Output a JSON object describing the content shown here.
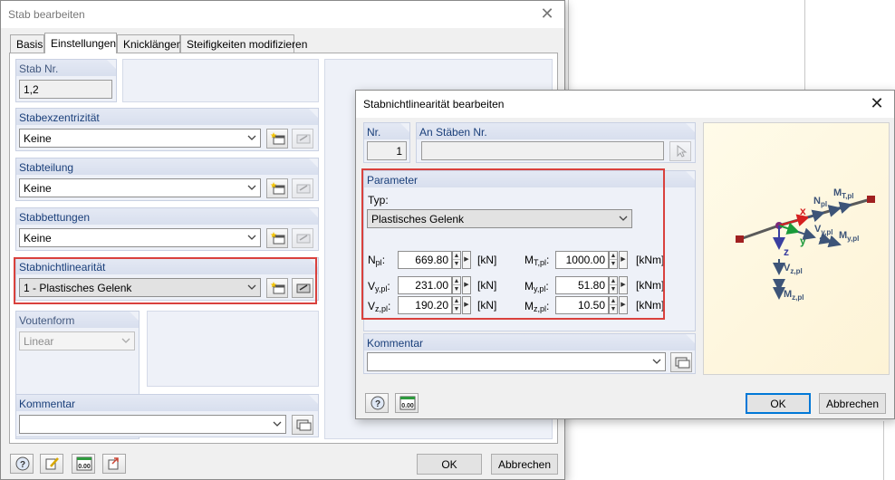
{
  "main_dialog": {
    "title": "Stab bearbeiten",
    "tabs": [
      "Basis",
      "Einstellungen",
      "Knicklängen",
      "Steifigkeiten modifizieren"
    ],
    "active_tab": "Einstellungen",
    "stab_nr": {
      "label": "Stab Nr.",
      "value": "1,2"
    },
    "exzentrizitaet": {
      "label": "Stabexzentrizität",
      "value": "Keine"
    },
    "teilung": {
      "label": "Stabteilung",
      "value": "Keine"
    },
    "bettungen": {
      "label": "Stabbettungen",
      "value": "Keine"
    },
    "nichtlinearitaet": {
      "label": "Stabnichtlinearität",
      "value": "1 - Plastisches Gelenk"
    },
    "voutenform": {
      "label": "Voutenform",
      "value": "Linear"
    },
    "kommentar": {
      "label": "Kommentar",
      "value": ""
    },
    "ok_label": "OK",
    "cancel_label": "Abbrechen",
    "calc_icon_text": "0.00"
  },
  "sub_dialog": {
    "title": "Stabnichtlinearität bearbeiten",
    "nr": {
      "label": "Nr.",
      "value": "1"
    },
    "an_staeben": {
      "label": "An Stäben Nr.",
      "value": ""
    },
    "parameter_label": "Parameter",
    "typ_label": "Typ:",
    "typ_value": "Plastisches Gelenk",
    "params_left": [
      {
        "base": "N",
        "sub": "pl",
        "colon": ":",
        "value": "669.80",
        "unit": "[kN]"
      },
      {
        "base": "V",
        "sub": "y,pl",
        "colon": ":",
        "value": "231.00",
        "unit": "[kN]"
      },
      {
        "base": "V",
        "sub": "z,pl",
        "colon": ":",
        "value": "190.20",
        "unit": "[kN]"
      }
    ],
    "params_right": [
      {
        "base": "M",
        "sub": "T,pl",
        "colon": ":",
        "value": "1000.00",
        "unit": "[kNm]"
      },
      {
        "base": "M",
        "sub": "y,pl",
        "colon": ":",
        "value": "51.80",
        "unit": "[kNm]"
      },
      {
        "base": "M",
        "sub": "z,pl",
        "colon": ":",
        "value": "10.50",
        "unit": "[kNm]"
      }
    ],
    "kommentar": {
      "label": "Kommentar",
      "value": ""
    },
    "ok_label": "OK",
    "cancel_label": "Abbrechen",
    "calc_icon_text": "0.00"
  },
  "diagram": {
    "axes": {
      "x": "x",
      "y": "y",
      "z": "z"
    },
    "labels": [
      {
        "base": "N",
        "sub": "pl"
      },
      {
        "base": "M",
        "sub": "T,pl"
      },
      {
        "base": "V",
        "sub": "y,pl"
      },
      {
        "base": "M",
        "sub": "y,pl"
      },
      {
        "base": "V",
        "sub": "z,pl"
      },
      {
        "base": "M",
        "sub": "z,pl"
      }
    ],
    "colors": {
      "axis_x": "#d62020",
      "axis_y": "#1a9a3a",
      "axis_z": "#3a3fa0",
      "force": "#3d5478",
      "member": "#5a5a5a"
    }
  },
  "accent": {
    "highlight": "#d9413d",
    "default_button": "#0078d7",
    "group_header_text": "#1a3f7a"
  }
}
